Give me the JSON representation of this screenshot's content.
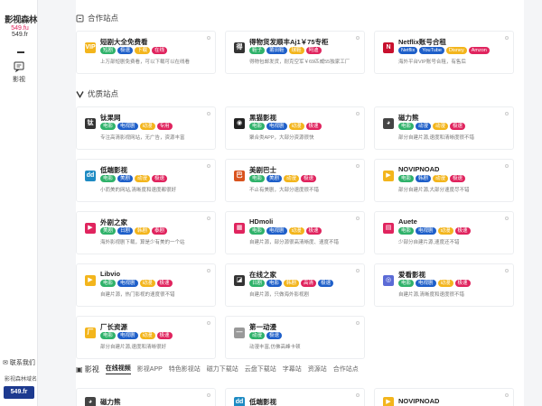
{
  "sidebar": {
    "logo_text": "影视森林",
    "logo_sub1": "549.fu",
    "logo_sub2": "549.fr",
    "nav_label": "影视",
    "contact": "联系我们",
    "domain_label": "影视森林域名",
    "domain_value": "549.fr"
  },
  "colors": {
    "sidebar_bg": "#ffffff",
    "accent_blue": "#1d3a8f",
    "tag_green": "#2fb26a",
    "tag_blue": "#1e5fc9",
    "tag_yellow": "#f3b51c",
    "tag_red": "#e0245e"
  },
  "sections": {
    "partner_title": "合作站点",
    "quality_title": "优质站点"
  },
  "partner_cards": [
    {
      "title": "短剧大全免费看",
      "icon": "vip-icon",
      "icon_text": "VIP",
      "icon_color": "#f3b51c",
      "tags": [
        {
          "t": "短剧",
          "c": "#2fb26a"
        },
        {
          "t": "极速",
          "c": "#1e5fc9"
        },
        {
          "t": "下载",
          "c": "#f3b51c"
        },
        {
          "t": "在线",
          "c": "#e0245e"
        }
      ],
      "desc": "上万部短剧免费看，可以下载可以在线看"
    },
    {
      "title": "得物货发顺丰Aj1￥75专柜",
      "icon": "bag-icon",
      "icon_text": "得",
      "icon_color": "#333333",
      "tags": [
        {
          "t": "鞋子",
          "c": "#2fb26a"
        },
        {
          "t": "莆田鞋",
          "c": "#1e5fc9"
        },
        {
          "t": "球鞋",
          "c": "#f3b51c"
        },
        {
          "t": "阿迪",
          "c": "#e0245e"
        }
      ],
      "desc": "得物包邮发货，耐克空军￥69匹威55独家工厂"
    },
    {
      "title": "Netflix账号合租",
      "icon": "netflix-icon",
      "icon_text": "N",
      "icon_color": "#c8102e",
      "tags": [
        {
          "t": "Netflix",
          "c": "#1e5fc9"
        },
        {
          "t": "YouTube",
          "c": "#1e5fc9"
        },
        {
          "t": "Disney",
          "c": "#f3b51c"
        },
        {
          "t": "Amzon",
          "c": "#e0245e"
        }
      ],
      "desc": "海外平台VIP账号合租，有售后"
    }
  ],
  "quality_cards": [
    {
      "title": "钛果网",
      "icon": "taiguo-icon",
      "icon_text": "钛",
      "icon_color": "#333333",
      "tags": [
        {
          "t": "电影",
          "c": "#2fb26a"
        },
        {
          "t": "电视剧",
          "c": "#1e5fc9"
        },
        {
          "t": "动漫",
          "c": "#f3b51c"
        },
        {
          "t": "专用",
          "c": "#e0245e"
        }
      ],
      "desc": "专注高清影视网站，无广告，资源丰富"
    },
    {
      "title": "黑猫影视",
      "icon": "github-cat-icon",
      "icon_text": "◉",
      "icon_color": "#222222",
      "tags": [
        {
          "t": "电影",
          "c": "#2fb26a"
        },
        {
          "t": "电视剧",
          "c": "#1e5fc9"
        },
        {
          "t": "动漫",
          "c": "#f3b51c"
        },
        {
          "t": "极速",
          "c": "#e0245e"
        }
      ],
      "desc": "聚合类APP，大部分资源很快"
    },
    {
      "title": "磁力熊",
      "icon": "panda-icon",
      "icon_text": "◕",
      "icon_color": "#444444",
      "tags": [
        {
          "t": "电影",
          "c": "#2fb26a"
        },
        {
          "t": "动漫",
          "c": "#1e5fc9"
        },
        {
          "t": "动漫",
          "c": "#f3b51c"
        },
        {
          "t": "极速",
          "c": "#e0245e"
        }
      ],
      "desc": "部分自建片源,速度和清晰度很不错"
    },
    {
      "title": "低端影视",
      "icon": "dd-icon",
      "icon_text": "dd",
      "icon_color": "#1e8bc3",
      "tags": [
        {
          "t": "电影",
          "c": "#2fb26a"
        },
        {
          "t": "美剧",
          "c": "#1e5fc9"
        },
        {
          "t": "动漫",
          "c": "#f3b51c"
        },
        {
          "t": "极速",
          "c": "#e0245e"
        }
      ],
      "desc": "小而美的网站,清晰度和速度都很好"
    },
    {
      "title": "美剧巴士",
      "icon": "bus-icon",
      "icon_text": "巴",
      "icon_color": "#d9531e",
      "tags": [
        {
          "t": "电影",
          "c": "#2fb26a"
        },
        {
          "t": "美剧",
          "c": "#1e5fc9"
        },
        {
          "t": "动漫",
          "c": "#f3b51c"
        },
        {
          "t": "极速",
          "c": "#e0245e"
        }
      ],
      "desc": "不止有美剧，大部分速度很不错"
    },
    {
      "title": "NOVIPNOAD",
      "icon": "play-icon",
      "icon_text": "▶",
      "icon_color": "#f3b51c",
      "tags": [
        {
          "t": "电影",
          "c": "#2fb26a"
        },
        {
          "t": "韩剧",
          "c": "#1e5fc9"
        },
        {
          "t": "动漫",
          "c": "#f3b51c"
        },
        {
          "t": "极速",
          "c": "#e0245e"
        }
      ],
      "desc": "部分自建片源,大部分速度尽不错"
    },
    {
      "title": "外剧之家",
      "icon": "play-circle-icon",
      "icon_text": "▶",
      "icon_color": "#e0245e",
      "tags": [
        {
          "t": "美剧",
          "c": "#2fb26a"
        },
        {
          "t": "日剧",
          "c": "#1e5fc9"
        },
        {
          "t": "韩剧",
          "c": "#f3b51c"
        },
        {
          "t": "泰剧",
          "c": "#e0245e"
        }
      ],
      "desc": "海外影视剧下载，算是少有美的一个站"
    },
    {
      "title": "HDmoli",
      "icon": "film-icon",
      "icon_text": "▦",
      "icon_color": "#e0245e",
      "tags": [
        {
          "t": "电影",
          "c": "#2fb26a"
        },
        {
          "t": "电视剧",
          "c": "#1e5fc9"
        },
        {
          "t": "动漫",
          "c": "#f3b51c"
        },
        {
          "t": "极速",
          "c": "#e0245e"
        }
      ],
      "desc": "自建片源，部分源很高清晰度、速度不错"
    },
    {
      "title": "Auete",
      "icon": "tv-icon",
      "icon_text": "▤",
      "icon_color": "#e0245e",
      "tags": [
        {
          "t": "电影",
          "c": "#2fb26a"
        },
        {
          "t": "电视剧",
          "c": "#1e5fc9"
        },
        {
          "t": "动漫",
          "c": "#f3b51c"
        },
        {
          "t": "极速",
          "c": "#e0245e"
        }
      ],
      "desc": "少部分自建片源,速度还不错"
    },
    {
      "title": "Libvio",
      "icon": "libvio-icon",
      "icon_text": "▶",
      "icon_color": "#f3b51c",
      "tags": [
        {
          "t": "电影",
          "c": "#2fb26a"
        },
        {
          "t": "电视剧",
          "c": "#1e5fc9"
        },
        {
          "t": "动漫",
          "c": "#f3b51c"
        },
        {
          "t": "极速",
          "c": "#e0245e"
        }
      ],
      "desc": "自建片源，热门影视的速度很不错"
    },
    {
      "title": "在线之家",
      "icon": "clapper-icon",
      "icon_text": "◪",
      "icon_color": "#333333",
      "tags": [
        {
          "t": "日剧",
          "c": "#2fb26a"
        },
        {
          "t": "电影",
          "c": "#1e5fc9"
        },
        {
          "t": "韩剧",
          "c": "#f3b51c"
        },
        {
          "t": "高清",
          "c": "#e0245e"
        },
        {
          "t": "极速",
          "c": "#1e5fc9"
        }
      ],
      "desc": "自建片源，只做海外影视剧"
    },
    {
      "title": "爱看影视",
      "icon": "aikan-icon",
      "icon_text": "◎",
      "icon_color": "#5b6bd6",
      "tags": [
        {
          "t": "电影",
          "c": "#2fb26a"
        },
        {
          "t": "电视剧",
          "c": "#1e5fc9"
        },
        {
          "t": "动漫",
          "c": "#f3b51c"
        },
        {
          "t": "极速",
          "c": "#e0245e"
        }
      ],
      "desc": "自建片源,清晰度和速度很不错"
    },
    {
      "title": "厂长资源",
      "icon": "factory-icon",
      "icon_text": "厂",
      "icon_color": "#f3b51c",
      "tags": [
        {
          "t": "电影",
          "c": "#2fb26a"
        },
        {
          "t": "电视剧",
          "c": "#1e5fc9"
        },
        {
          "t": "动漫",
          "c": "#f3b51c"
        },
        {
          "t": "极速",
          "c": "#e0245e"
        }
      ],
      "desc": "部分自建片源,速度和清晰很好"
    },
    {
      "title": "第一动漫",
      "icon": "dash-icon",
      "icon_text": "—",
      "icon_color": "#999999",
      "tags": [
        {
          "t": "动漫",
          "c": "#2fb26a"
        },
        {
          "t": "极速",
          "c": "#1e5fc9"
        }
      ],
      "desc": "动漫丰富,仿佛高峰卡顿"
    }
  ],
  "tabs": {
    "section_label": "影视",
    "items": [
      "在线视频",
      "影视APP",
      "特色影视站",
      "磁力下载站",
      "云盘下载站",
      "字幕站",
      "资源站",
      "合作站点"
    ]
  },
  "bottom_cards": [
    {
      "title": "磁力熊",
      "icon": "panda-icon",
      "icon_text": "◕",
      "icon_color": "#444444"
    },
    {
      "title": "低端影视",
      "icon": "dd-icon",
      "icon_text": "dd",
      "icon_color": "#1e8bc3"
    },
    {
      "title": "NOVIPNOAD",
      "icon": "play-icon",
      "icon_text": "▶",
      "icon_color": "#f3b51c"
    }
  ]
}
